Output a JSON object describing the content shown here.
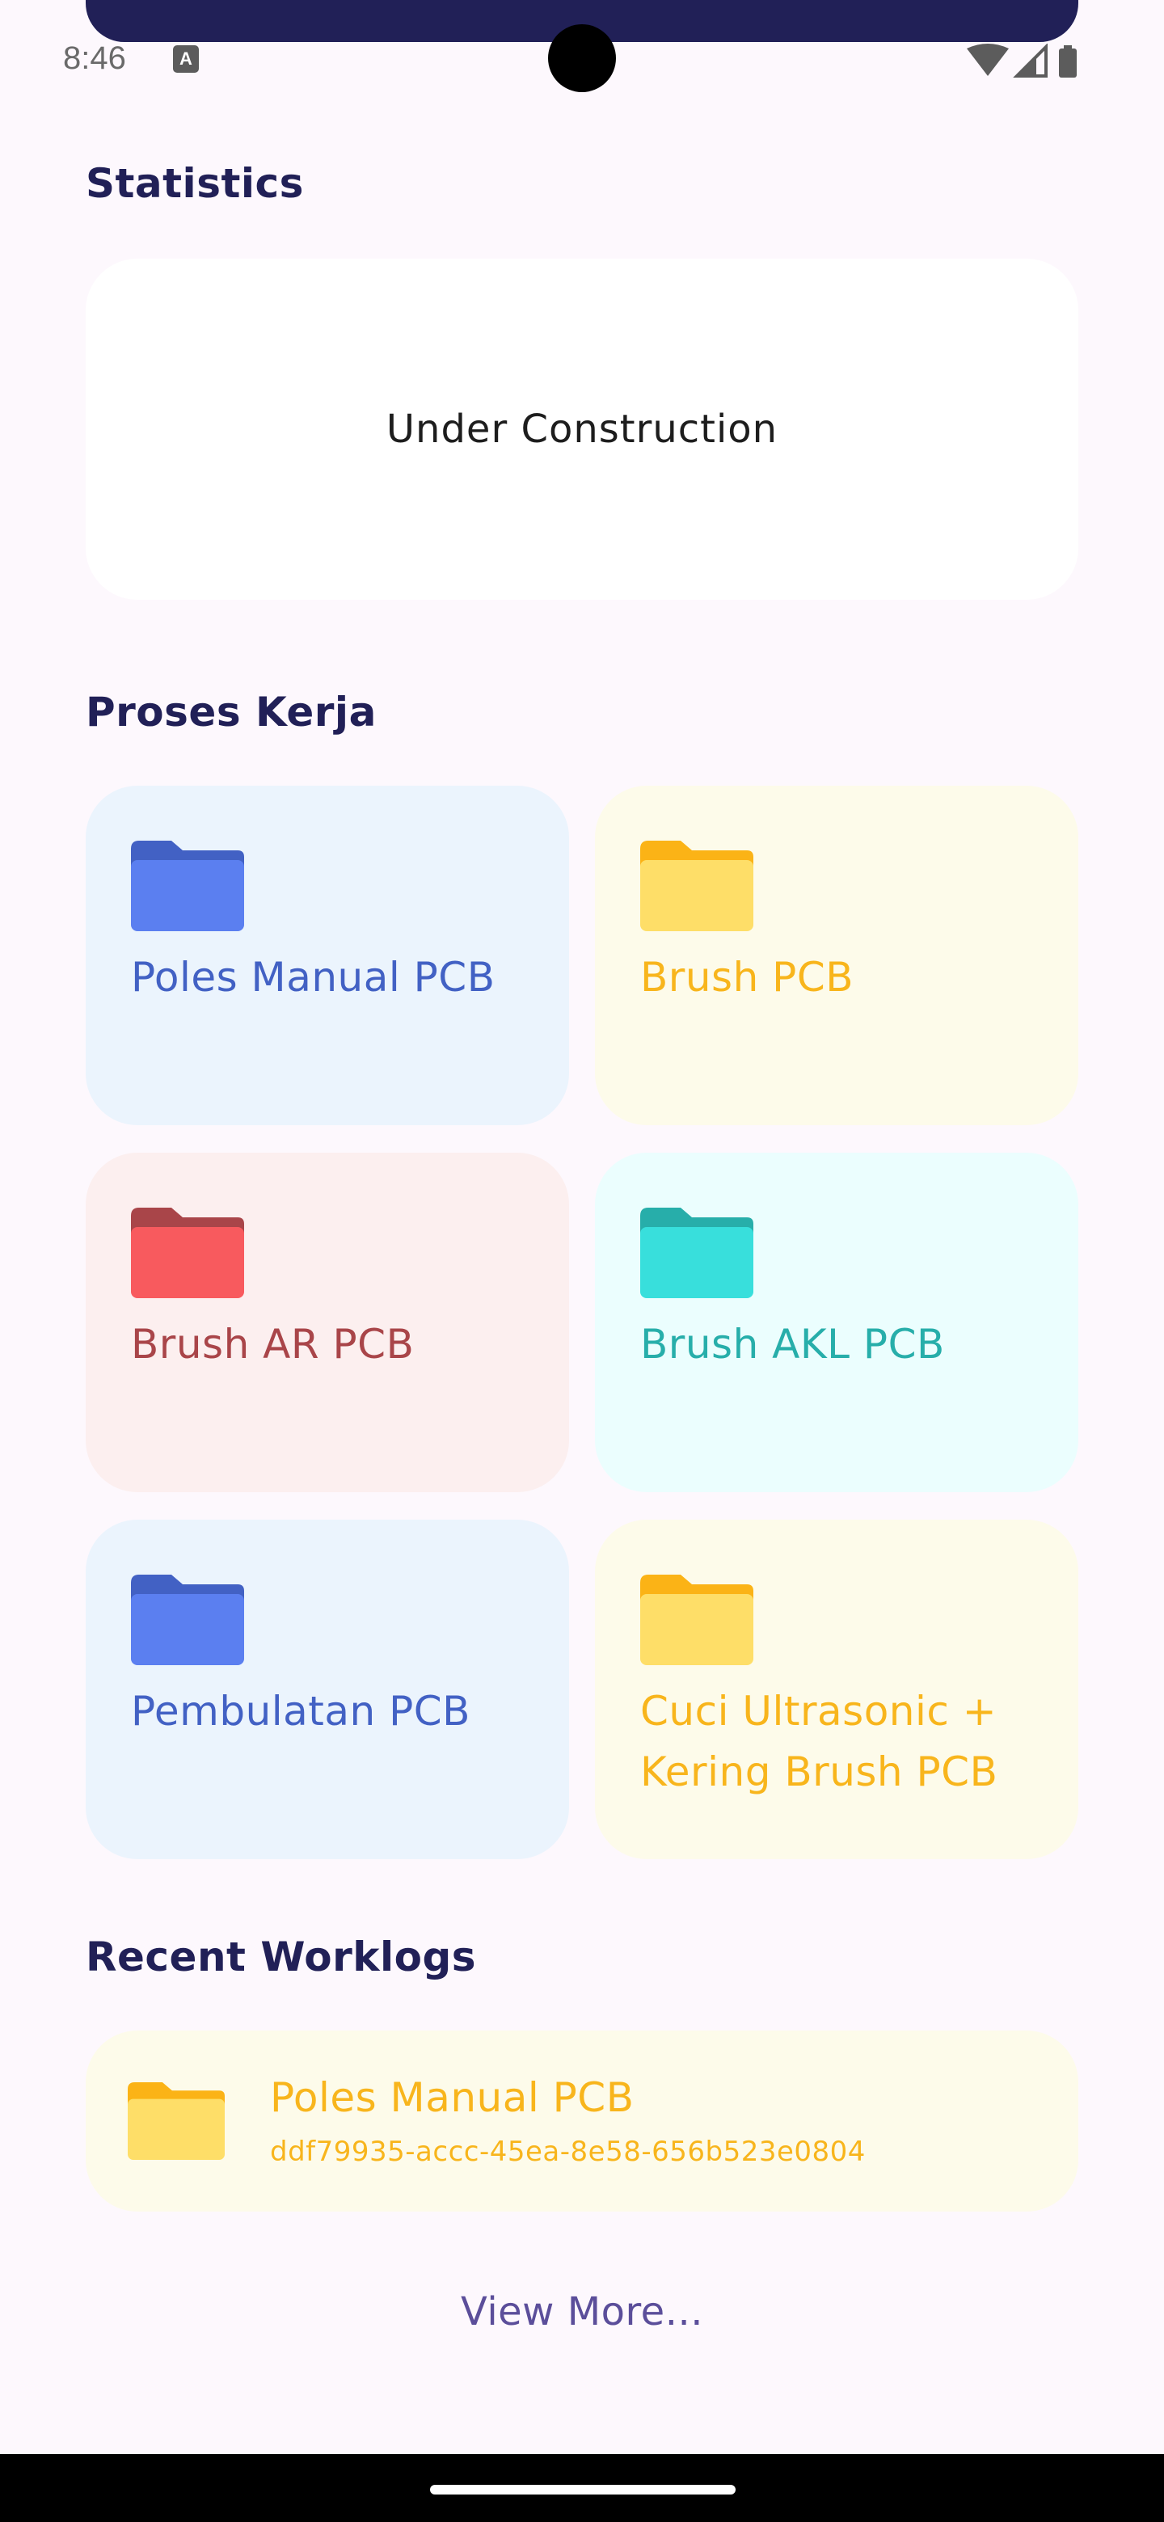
{
  "status_bar": {
    "time": "8:46",
    "notification_icon": "text-a-icon",
    "icons": [
      "wifi-icon",
      "signal-icon",
      "battery-icon"
    ]
  },
  "statistics": {
    "title": "Statistics",
    "placeholder": "Under Construction"
  },
  "proses_kerja": {
    "title": "Proses Kerja",
    "items": [
      {
        "label": "Poles Manual PCB",
        "color": "blue"
      },
      {
        "label": "Brush PCB",
        "color": "yellow"
      },
      {
        "label": "Brush AR PCB",
        "color": "red"
      },
      {
        "label": "Brush AKL PCB",
        "color": "cyan"
      },
      {
        "label": "Pembulatan PCB",
        "color": "blue"
      },
      {
        "label": "Cuci Ultrasonic + Kering Brush PCB",
        "color": "yellow"
      }
    ]
  },
  "recent_worklogs": {
    "title": "Recent Worklogs",
    "items": [
      {
        "title": "Poles Manual PCB",
        "id": "ddf79935-accc-45ea-8e58-656b523e0804"
      }
    ],
    "view_more": "View More..."
  },
  "colors": {
    "header": "#212057",
    "background": "#fdf8fd",
    "blue_folder": "#5b7ff0",
    "yellow_folder": "#fede68",
    "red_folder": "#f85a5e",
    "cyan_folder": "#38dfdc"
  }
}
